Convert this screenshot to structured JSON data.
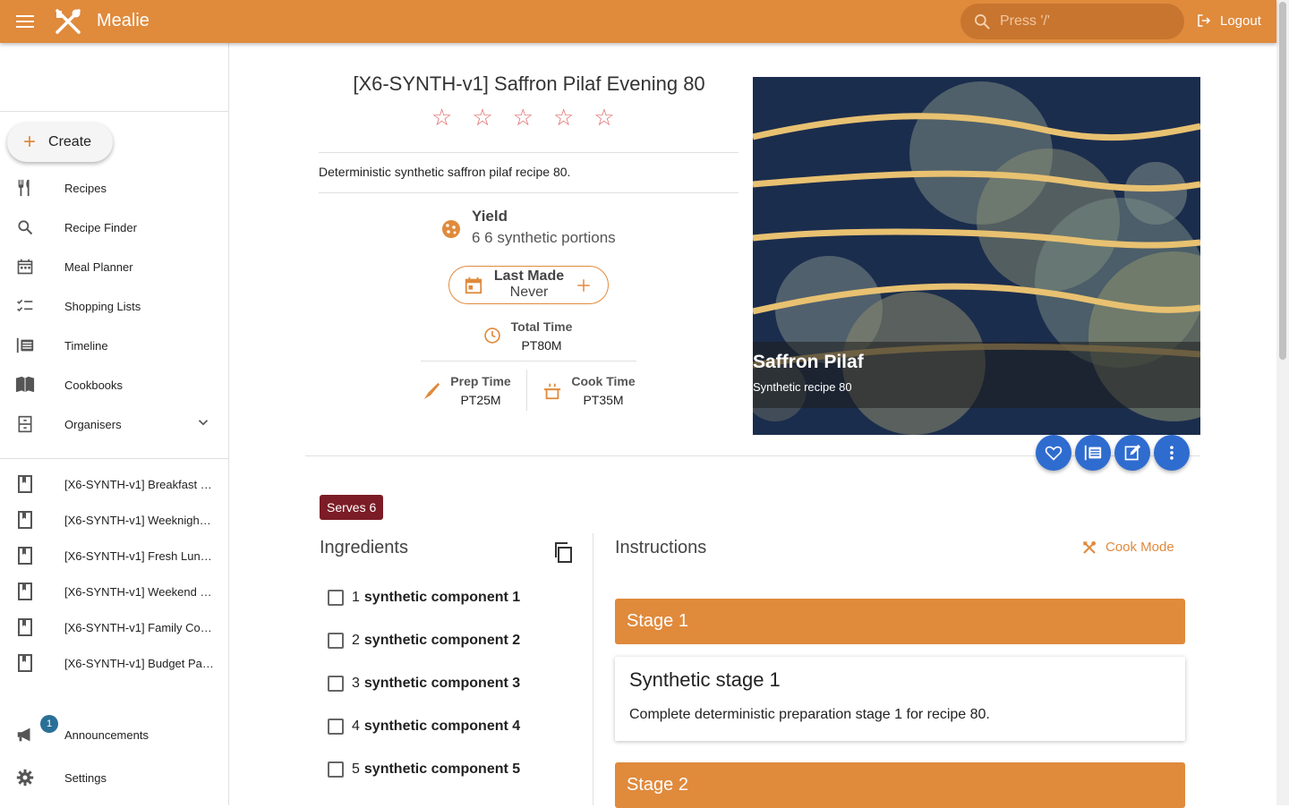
{
  "app": {
    "name": "Mealie",
    "search_placeholder": "Press '/'",
    "logout_label": "Logout",
    "accent": "#e08a3c"
  },
  "sidebar": {
    "create_label": "Create",
    "items": [
      {
        "label": "Recipes",
        "icon": "fork-knife-icon"
      },
      {
        "label": "Recipe Finder",
        "icon": "search-icon"
      },
      {
        "label": "Meal Planner",
        "icon": "calendar-icon"
      },
      {
        "label": "Shopping Lists",
        "icon": "checklist-icon"
      },
      {
        "label": "Timeline",
        "icon": "timeline-icon"
      },
      {
        "label": "Cookbooks",
        "icon": "book-open-icon"
      },
      {
        "label": "Organisers",
        "icon": "cabinet-icon"
      }
    ],
    "cookbooks": [
      "[X6-SYNTH-v1] Breakfast …",
      "[X6-SYNTH-v1] Weeknigh…",
      "[X6-SYNTH-v1] Fresh Lun…",
      "[X6-SYNTH-v1] Weekend …",
      "[X6-SYNTH-v1] Family Co…",
      "[X6-SYNTH-v1] Budget Pa…"
    ],
    "announcements_label": "Announcements",
    "announcements_count": "1",
    "settings_label": "Settings"
  },
  "recipe": {
    "title": "[X6-SYNTH-v1] Saffron Pilaf Evening 80",
    "rating_stars": 5,
    "rating_value": 0,
    "description": "Deterministic synthetic saffron pilaf recipe 80.",
    "yield_label": "Yield",
    "yield_value": "6 6 synthetic portions",
    "last_made_label": "Last Made",
    "last_made_value": "Never",
    "total_time_label": "Total Time",
    "total_time_value": "PT80M",
    "prep_time_label": "Prep Time",
    "prep_time_value": "PT25M",
    "cook_time_label": "Cook Time",
    "cook_time_value": "PT35M",
    "image_title": "Saffron Pilaf",
    "image_subtitle": "Synthetic recipe 80",
    "serves_label": "Serves 6"
  },
  "ingredients": {
    "heading": "Ingredients",
    "items": [
      {
        "qty": "1",
        "name": "synthetic component 1"
      },
      {
        "qty": "2",
        "name": "synthetic component 2"
      },
      {
        "qty": "3",
        "name": "synthetic component 3"
      },
      {
        "qty": "4",
        "name": "synthetic component 4"
      },
      {
        "qty": "5",
        "name": "synthetic component 5"
      }
    ]
  },
  "instructions": {
    "heading": "Instructions",
    "cook_mode_label": "Cook Mode",
    "stages": [
      {
        "label": "Stage 1",
        "title": "Synthetic stage 1",
        "text": "Complete deterministic preparation stage 1 for recipe 80."
      },
      {
        "label": "Stage 2"
      }
    ]
  }
}
